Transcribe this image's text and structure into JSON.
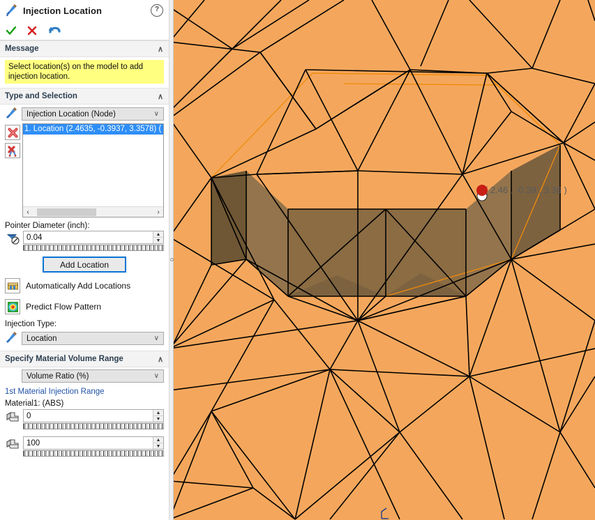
{
  "panel": {
    "title": "Injection Location",
    "title_icon": "injection-nozzle-icon",
    "help_label": "?",
    "actions": {
      "ok_label": "✓",
      "cancel_label": "✕",
      "undo_label": "undo-arrow-icon"
    },
    "message_section": {
      "header": "Message",
      "collapse_chevron": "∧",
      "text": "Select location(s) on the model to add injection location."
    },
    "type_selection": {
      "header": "Type and Selection",
      "collapse_chevron": "∧",
      "type_combo": {
        "value": "Injection Location (Node)",
        "chevron": "∨",
        "options": [
          "Injection Location (Node)"
        ]
      },
      "list_items": [
        "1. Location (2.4635, -0.3937, 3.3578) ("
      ],
      "tool_icons": [
        "delete-location-icon",
        "delete-all-locations-icon"
      ],
      "hscroll": {
        "left_arrow": "‹",
        "right_arrow": "›"
      }
    },
    "pointer_diameter": {
      "label": "Pointer Diameter (inch):",
      "value": "0.04",
      "spin_up": "▲",
      "spin_down": "▼"
    },
    "add_location_button": "Add Location",
    "checkboxes": [
      {
        "label": "Automatically Add Locations",
        "icon": "auto-add-locations-icon"
      },
      {
        "label": "Predict Flow Pattern",
        "icon": "predict-flow-pattern-icon"
      }
    ],
    "injection_type": {
      "label": "Injection Type:",
      "value": "Location",
      "chevron": "∨",
      "options": [
        "Location"
      ]
    },
    "material_volume": {
      "header": "Specify Material Volume Range",
      "collapse_chevron": "∧",
      "unit_combo": {
        "value": "Volume Ratio (%)",
        "chevron": "∨",
        "options": [
          "Volume Ratio (%)"
        ]
      },
      "range_link": "1st Material Injection Range",
      "material_label": "Material1: (ABS)",
      "min_value": "0",
      "max_value": "100",
      "spin_up": "▲",
      "spin_down": "▼"
    }
  },
  "viewport": {
    "coordinate_label": "( 2.46 , -0.39 , 3.36  )",
    "pick_point_color": "#c81e14",
    "mesh_fill": "#f4a75c",
    "mesh_line": "#000000",
    "mesh_highlight_outline": "#f08a0a",
    "recess_face_dark": "#7d6240",
    "recess_face_mid": "#8e7049",
    "recess_face_light": "#a07f55"
  }
}
